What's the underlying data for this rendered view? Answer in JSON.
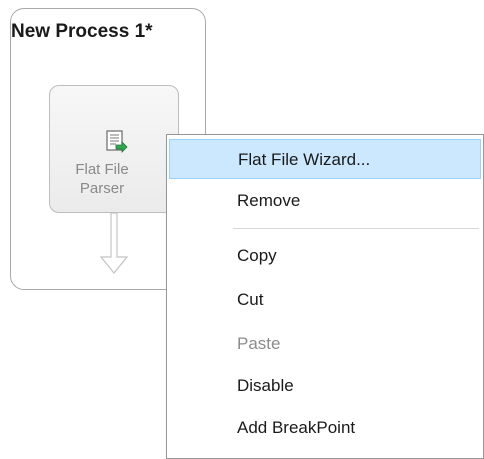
{
  "process": {
    "title": "New Process 1*"
  },
  "node": {
    "label_line1": "Flat File",
    "label_line2": "Parser",
    "icon": "flat-file-parser-icon"
  },
  "context_menu": {
    "items": [
      {
        "label": "Flat File Wizard...",
        "state": "highlighted"
      },
      {
        "label": "Remove",
        "state": "enabled"
      },
      {
        "label": "Copy",
        "state": "enabled"
      },
      {
        "label": "Cut",
        "state": "enabled"
      },
      {
        "label": "Paste",
        "state": "disabled"
      },
      {
        "label": "Disable",
        "state": "enabled"
      },
      {
        "label": "Add BreakPoint",
        "state": "enabled"
      }
    ]
  },
  "colors": {
    "highlight_bg": "#cce8ff",
    "highlight_border": "#99d1ff",
    "disabled_text": "#8c8c8c",
    "icon_green": "#2fa84f"
  }
}
